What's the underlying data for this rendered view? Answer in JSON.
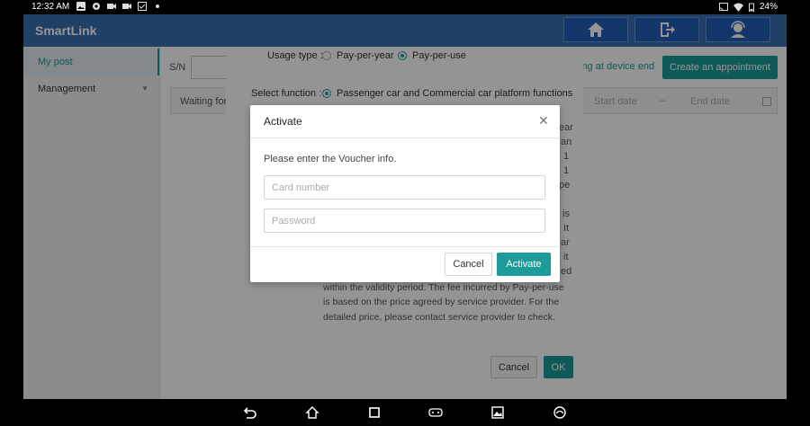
{
  "status_bar": {
    "time": "12:32 AM",
    "battery": "24%",
    "left_icons": [
      "image-icon",
      "gear-icon",
      "video-icon",
      "video-icon",
      "checkbox-icon",
      "dot-icon"
    ],
    "right_icons": [
      "cast-icon",
      "wifi-icon",
      "battery-icon"
    ]
  },
  "app": {
    "title": "SmartLink",
    "header_buttons": [
      "home-icon",
      "logout-icon",
      "user-support-icon"
    ],
    "sidebar": [
      {
        "label": "My post",
        "active": true
      },
      {
        "label": "Management",
        "active": false
      }
    ],
    "main": {
      "sn_label": "S/N",
      "ahead_text": "ing at device end",
      "create_button": "Create an appointment",
      "filter": {
        "waiting_label": "Waiting for",
        "start_date": "Start date",
        "separator": "–",
        "end_date": "End date"
      }
    }
  },
  "service_modal": {
    "usage_type_label": "Usage type :",
    "usage_options": [
      "Pay-per-year",
      "Pay-per-use"
    ],
    "usage_selected": "Pay-per-use",
    "select_function_label": "Select function :",
    "function_option": "Passenger car and Commercial car platform functions",
    "description_fragments": {
      "right_edge": [
        "ear",
        "an",
        "1",
        "1",
        "pe",
        "",
        "is",
        "It",
        "ar",
        "it",
        "ed"
      ],
      "visible_lines": [
        "within the validity period. The fee incurred by Pay-per-use",
        "is based on the price agreed by service provider. For the",
        "detailed price, please contact service provider to check."
      ]
    },
    "cancel_button": "Cancel",
    "ok_button": "OK"
  },
  "activate_modal": {
    "title": "Activate",
    "prompt": "Please enter the Voucher info.",
    "card_number": {
      "value": "",
      "placeholder": "Card number"
    },
    "password": {
      "value": "",
      "placeholder": "Password"
    },
    "cancel_button": "Cancel",
    "activate_button": "Activate"
  },
  "colors": {
    "accent": "#1d9a9a",
    "header": "#3a6fb0"
  }
}
